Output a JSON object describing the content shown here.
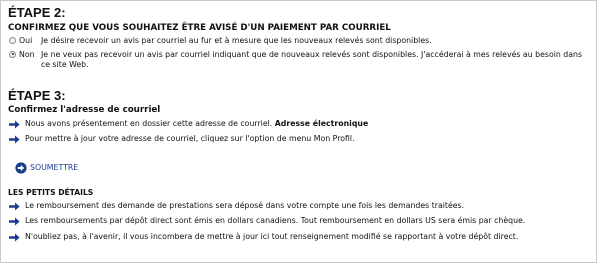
{
  "step2": {
    "heading": "ÉTAPE 2:",
    "subheading": "CONFIRMEZ QUE VOUS SOUHAITEZ ÊTRE AVISÉ D'UN PAIEMENT PAR COURRIEL",
    "options": [
      {
        "label": "Oui",
        "text": "Je désire recevoir un avis par courriel au fur et à mesure que les nouveaux relevés sont disponibles.",
        "selected": false
      },
      {
        "label": "Non",
        "text": "Je ne veux pas recevoir un avis par courriel indiquant que de nouveaux relevés sont disponibles. J'accéderai à mes relevés au besoin dans ce site Web.",
        "selected": true
      }
    ]
  },
  "step3": {
    "heading": "ÉTAPE 3:",
    "subheading": "Confirmez l'adresse de courriel",
    "line1_prefix": "Nous avons présentement en dossier cette adresse de courriel.",
    "line1_value": "Adresse électronique",
    "line2": "Pour mettre à jour votre adresse de courriel, cliquez sur l'option de menu Mon Profil."
  },
  "submit": {
    "label": "SOUMETTRE"
  },
  "details": {
    "title": "LES PETITS DÉTAILS",
    "items": [
      "Le remboursement des demande de prestations sera déposé dans votre compte une fois les demandes traitées.",
      "Les remboursements par dépôt direct sont émis en dollars canadiens. Tout remboursement en dollars US sera émis par chèque.",
      "N'oubliez pas, à l'avenir, il vous incombera de mettre à jour ici tout renseignement modifié se rapportant à votre dépôt direct."
    ]
  },
  "colors": {
    "arrow": "#1b3f8f",
    "link": "#1b3f8f",
    "border": "#c8c8c8"
  },
  "icons": {
    "bullet": "arrow-right-icon",
    "submit": "circle-arrow-right-icon"
  }
}
